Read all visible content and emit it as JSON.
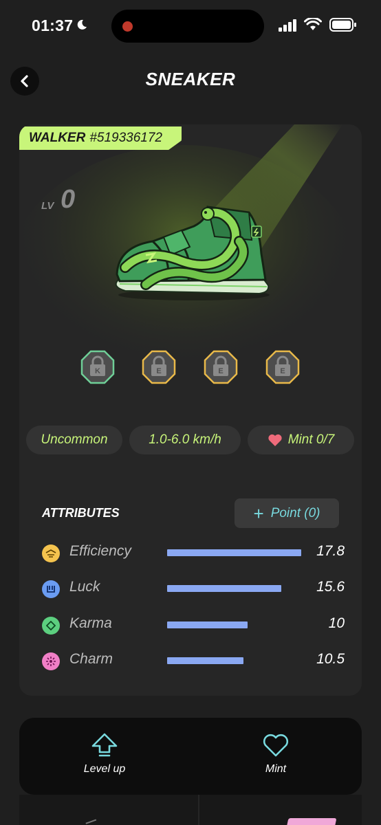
{
  "status_bar": {
    "time": "01:37",
    "icons": [
      "moon-icon",
      "signal-icon",
      "wifi-icon",
      "battery-icon"
    ]
  },
  "header": {
    "title": "SNEAKER",
    "back_icon": "chevron-left-icon"
  },
  "card": {
    "tag_type": "WALKER",
    "tag_id": "#519336172",
    "level_label": "LV",
    "level_value": "0",
    "sockets": [
      {
        "letter": "K",
        "color": "#6fcf97"
      },
      {
        "letter": "E",
        "color": "#e9b949"
      },
      {
        "letter": "E",
        "color": "#e9b949"
      },
      {
        "letter": "E",
        "color": "#e9b949"
      }
    ],
    "pills": {
      "rarity": "Uncommon",
      "speed": "1.0-6.0 km/h",
      "mint": "Mint 0/7"
    },
    "attributes_title": "ATTRIBUTES",
    "point_button": "Point (0)",
    "attributes": [
      {
        "name": "Efficiency",
        "value": "17.8",
        "fill": 1.0,
        "icon": "efficiency-icon",
        "color": "#f4c34e"
      },
      {
        "name": "Luck",
        "value": "15.6",
        "fill": 0.85,
        "icon": "luck-icon",
        "color": "#6a9cf2"
      },
      {
        "name": "Karma",
        "value": "10",
        "fill": 0.6,
        "icon": "karma-icon",
        "color": "#5ccf7f"
      },
      {
        "name": "Charm",
        "value": "10.5",
        "fill": 0.57,
        "icon": "charm-icon",
        "color": "#f07fc6"
      }
    ]
  },
  "actions": {
    "level_up": "Level up",
    "mint": "Mint"
  },
  "colors": {
    "accent_green": "#c8f57a",
    "accent_cyan": "#78d9de",
    "bar_blue": "#8aa8f2"
  }
}
